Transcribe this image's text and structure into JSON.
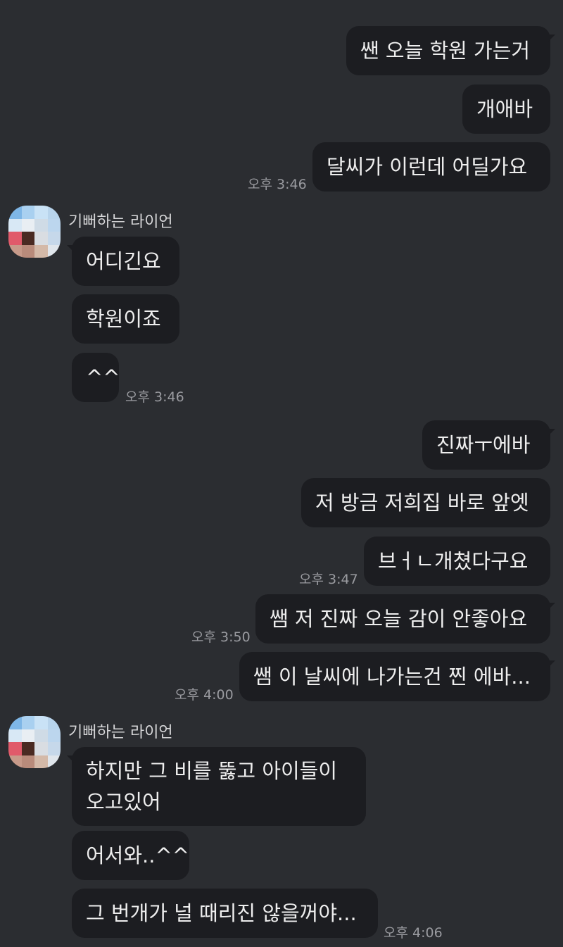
{
  "messages": {
    "m1": "쌘 오늘 학원 가는거",
    "m2": "개애바",
    "m3": "달씨가 이런데 어딜가요",
    "t1": "오후 3:46",
    "sender1": "기뻐하는 라이언",
    "m4": "어디긴요",
    "m5": "학원이죠",
    "m6": "^^",
    "t2": "오후 3:46",
    "m7": "진짜ㅜ에바",
    "m8": "저 방금 저희집 바로 앞엣",
    "m9": "브ㅓㄴ개쳤다구요",
    "t3": "오후 3:47",
    "m10": "쌤 저 진짜 오늘 감이 안좋아요",
    "t4": "오후 3:50",
    "m11": "쌤 이 날씨에 나가는건 찐 에바...",
    "t5": "오후 4:00",
    "sender2": "기뻐하는 라이언",
    "m12": "하지만 그 비를 뚫고 아이들이 오고있어",
    "m13": "어서와..^^",
    "m14": "그 번개가 널 때리진 않을꺼야...",
    "t6": "오후 4:06"
  },
  "colors": {
    "background": "#2b2d31",
    "bubble": "#1c1d21",
    "timestamp": "#9a9ba0"
  }
}
